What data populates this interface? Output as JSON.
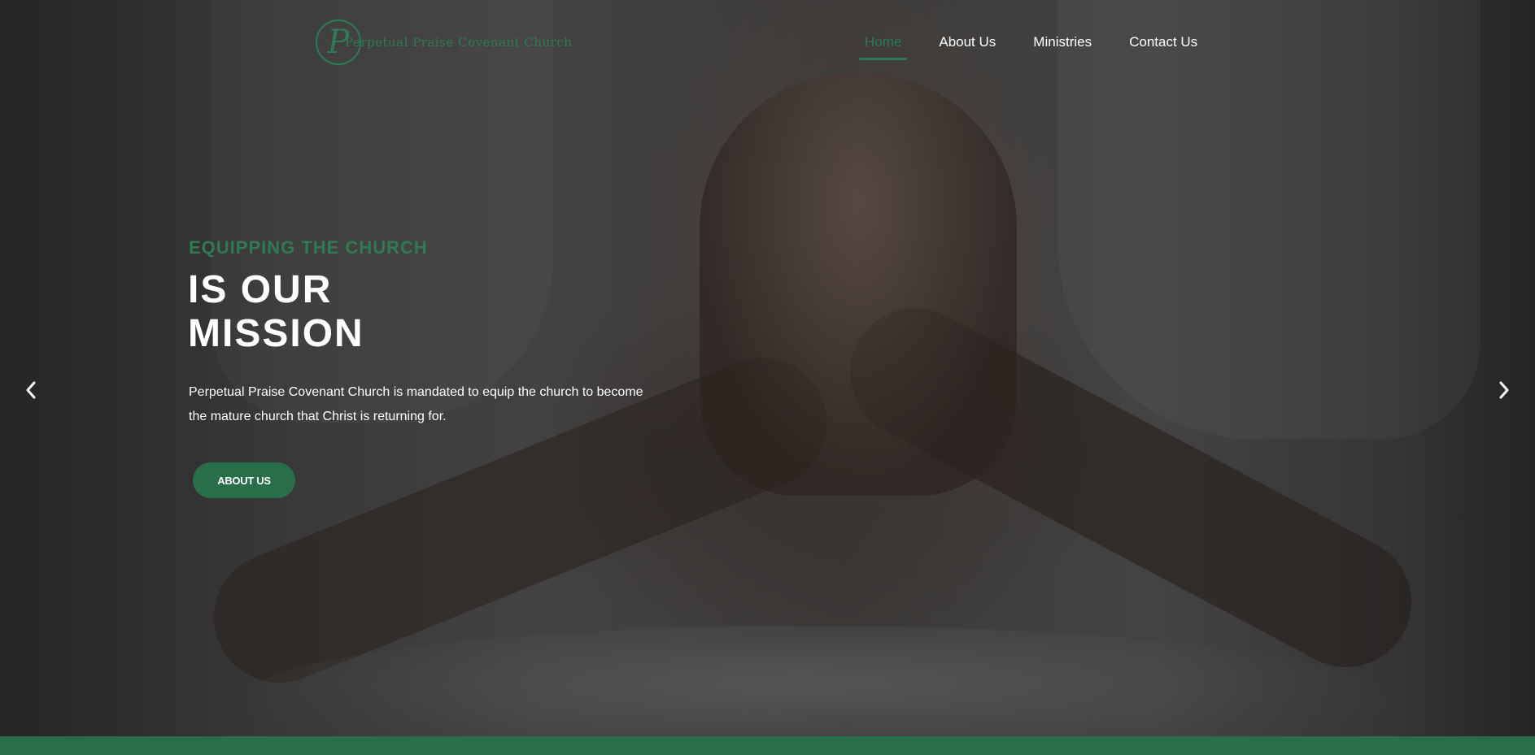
{
  "brand": {
    "logo_letter": "P",
    "name": "Perpetual Praise Covenant Church"
  },
  "nav": {
    "items": [
      {
        "label": "Home",
        "active": true
      },
      {
        "label": "About Us",
        "active": false
      },
      {
        "label": "Ministries",
        "active": false
      },
      {
        "label": "Contact Us",
        "active": false
      }
    ]
  },
  "hero": {
    "eyebrow": "EQUIPPING THE CHURCH",
    "headline_line1": "IS OUR",
    "headline_line2": "MISSION",
    "description": "Perpetual Praise Covenant Church is mandated to equip the church to become the mature church that Christ is returning for.",
    "cta_label": "ABOUT US"
  },
  "carousel": {
    "prev_icon": "chevron-left-icon",
    "next_icon": "chevron-right-icon"
  },
  "colors": {
    "accent": "#2e7a55",
    "button": "#276e49",
    "text": "#ffffff"
  }
}
